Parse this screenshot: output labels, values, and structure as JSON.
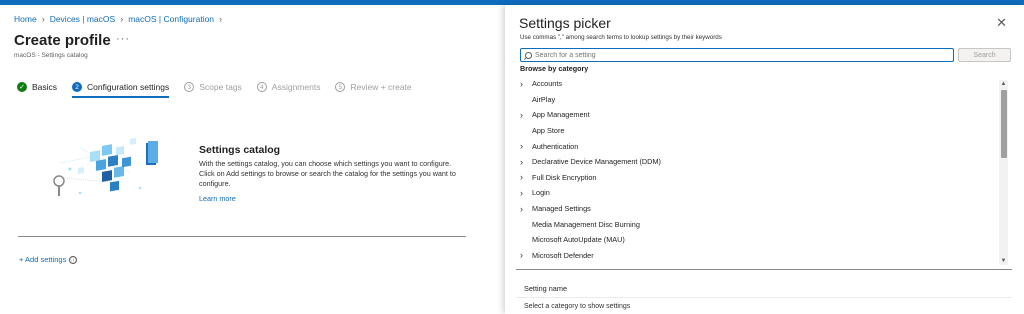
{
  "header": {
    "account_text": ""
  },
  "breadcrumb": {
    "items": [
      "Home",
      "Devices | macOS",
      "macOS | Configuration"
    ]
  },
  "page": {
    "title": "Create profile",
    "more": "···",
    "subtitle": "macOS - Settings catalog"
  },
  "wizard": {
    "steps": [
      {
        "number": "✓",
        "label": "Basics",
        "state": "done"
      },
      {
        "number": "2",
        "label": "Configuration settings",
        "state": "current"
      },
      {
        "number": "3",
        "label": "Scope tags",
        "state": "pending"
      },
      {
        "number": "4",
        "label": "Assignments",
        "state": "pending"
      },
      {
        "number": "5",
        "label": "Review + create",
        "state": "pending"
      }
    ]
  },
  "catalog": {
    "title": "Settings catalog",
    "description": "With the settings catalog, you can choose which settings you want to configure. Click on Add settings to browse or search the catalog for the settings you want to configure.",
    "learn_more": "Learn more",
    "add_settings": "+ Add settings",
    "info_icon": "ⓘ"
  },
  "picker": {
    "title": "Settings picker",
    "close": "✕",
    "hint": "Use commas \",\" among search terms to lookup settings by their keywords",
    "search_placeholder": "Search for a setting",
    "search_button": "Search",
    "browse_label": "Browse by category",
    "categories": [
      {
        "label": "Accounts",
        "expandable": true
      },
      {
        "label": "AirPlay",
        "expandable": false
      },
      {
        "label": "App Management",
        "expandable": true
      },
      {
        "label": "App Store",
        "expandable": false
      },
      {
        "label": "Authentication",
        "expandable": true
      },
      {
        "label": "Declarative Device Management (DDM)",
        "expandable": true
      },
      {
        "label": "Full Disk Encryption",
        "expandable": true
      },
      {
        "label": "Login",
        "expandable": true
      },
      {
        "label": "Managed Settings",
        "expandable": true
      },
      {
        "label": "Media Management Disc Burning",
        "expandable": false
      },
      {
        "label": "Microsoft AutoUpdate (MAU)",
        "expandable": false
      },
      {
        "label": "Microsoft Defender",
        "expandable": true
      }
    ],
    "setting_name_header": "Setting name",
    "setting_hint": "Select a category to show settings"
  },
  "colors": {
    "accent": "#0f6cbd",
    "success": "#107c10"
  },
  "icons": {
    "chevron": "chevron-right-icon",
    "search": "search-icon",
    "close": "close-icon",
    "info": "info-icon"
  }
}
